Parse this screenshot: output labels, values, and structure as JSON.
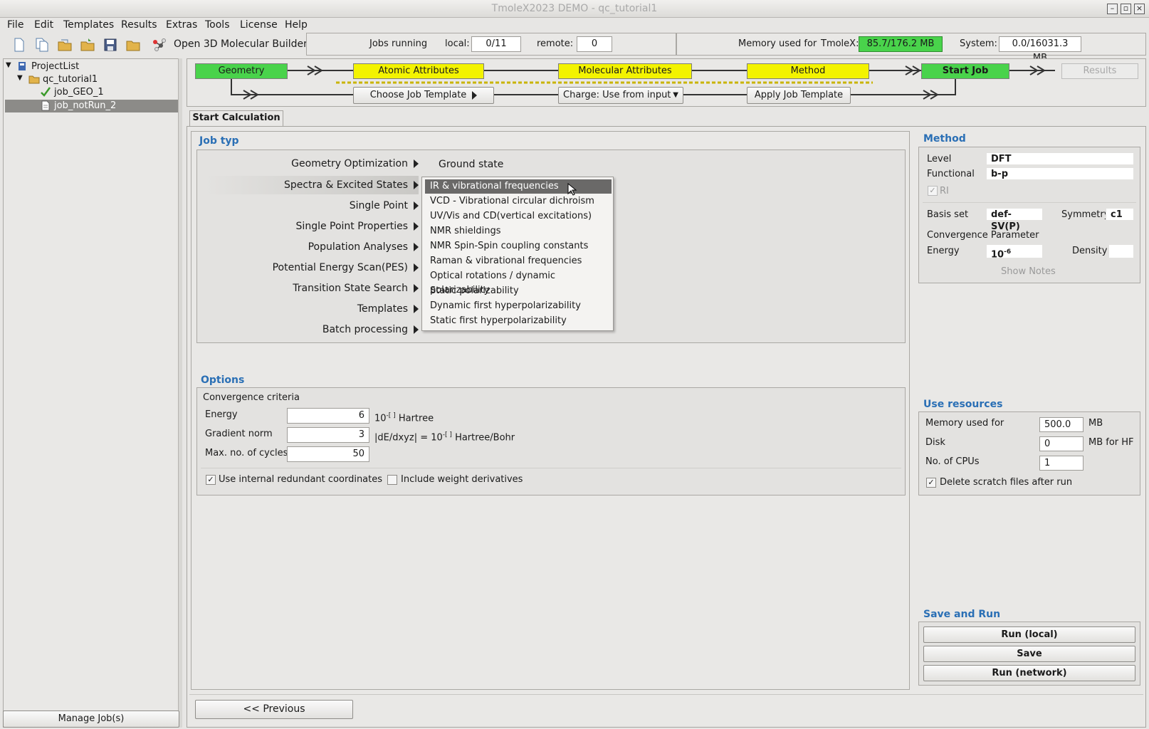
{
  "window": {
    "title": "TmoleX2023 DEMO - qc_tutorial1"
  },
  "menu": [
    "File",
    "Edit",
    "Templates",
    "Results",
    "Extras",
    "Tools",
    "License",
    "Help"
  ],
  "toolbar": {
    "builder_label": "Open 3D Molecular Builder",
    "jobs_running": "Jobs running",
    "local_label": "local:",
    "local_value": "0/11",
    "remote_label": "remote:",
    "remote_value": "0",
    "memory_label": "Memory used for",
    "tmolex_label": "TmoleX:",
    "tmolex_value": "85.7/176.2 MB",
    "system_label": "System:",
    "system_value": "0.0/16031.3 MB"
  },
  "tree": {
    "root": "ProjectList",
    "project": "qc_tutorial1",
    "jobs": [
      "job_GEO_1",
      "job_notRun_2"
    ],
    "manage": "Manage Job(s)"
  },
  "workflow": {
    "geometry": "Geometry",
    "atomic": "Atomic Attributes",
    "molecular": "Molecular Attributes",
    "method": "Method",
    "start": "Start Job",
    "results": "Results",
    "choose_template": "Choose Job Template",
    "charge": "Charge:  Use from input",
    "apply_template": "Apply Job Template"
  },
  "tab": "Start Calculation",
  "jobtype": {
    "title": "Job typ",
    "items": [
      "Geometry Optimization",
      "Spectra & Excited States",
      "Single Point",
      "Single Point Properties",
      "Population Analyses",
      "Potential Energy Scan(PES)",
      "Transition State Search",
      "Templates",
      "Batch processing"
    ],
    "ground_state": "Ground state",
    "popup": [
      "IR & vibrational frequencies",
      "VCD - Vibrational circular dichroism",
      "UV/Vis and CD(vertical excitations)",
      "NMR shieldings",
      "NMR Spin-Spin coupling constants",
      "Raman & vibrational frequencies",
      "Optical rotations / dynamic polarizability",
      "Static polarizability",
      "Dynamic first hyperpolarizability",
      "Static first hyperpolarizability"
    ]
  },
  "options": {
    "title": "Options",
    "criteria": "Convergence criteria",
    "energy_label": "Energy",
    "energy_value": "6",
    "energy_unit_base": "10",
    "energy_unit_exp": "-[ ]",
    "energy_unit": "Hartree",
    "grad_label": "Gradient norm",
    "grad_value": "3",
    "grad_unit_pre": "|dE/dxyz| = 10",
    "grad_unit_exp": "-[ ]",
    "grad_unit": "Hartree/Bohr",
    "cycles_label": "Max. no. of cycles",
    "cycles_value": "50",
    "internal": "Use internal redundant coordinates",
    "weight": "Include weight derivatives"
  },
  "method": {
    "title": "Method",
    "level_label": "Level",
    "level": "DFT",
    "functional_label": "Functional",
    "functional": "b-p",
    "ri": "RI",
    "basis_label": "Basis set",
    "basis": "def-SV(P)",
    "symmetry_label": "Symmetry",
    "symmetry": "c1",
    "conv_label": "Convergence Parameter",
    "energy_label": "Energy",
    "energy_base": "10",
    "energy_exp": "-6",
    "density_label": "Density",
    "density": "",
    "notes": "Show Notes"
  },
  "resources": {
    "title": "Use resources",
    "mem_label": "Memory used for",
    "mem": "500.0",
    "mem_unit": "MB",
    "disk_label": "Disk",
    "disk": "0",
    "disk_unit": "MB for HF",
    "cpu_label": "No. of CPUs",
    "cpu": "1",
    "scratch": "Delete scratch files after run"
  },
  "run": {
    "title": "Save and Run",
    "local": "Run (local)",
    "save": "Save",
    "network": "Run (network)"
  },
  "nav": {
    "previous": "<< Previous"
  }
}
